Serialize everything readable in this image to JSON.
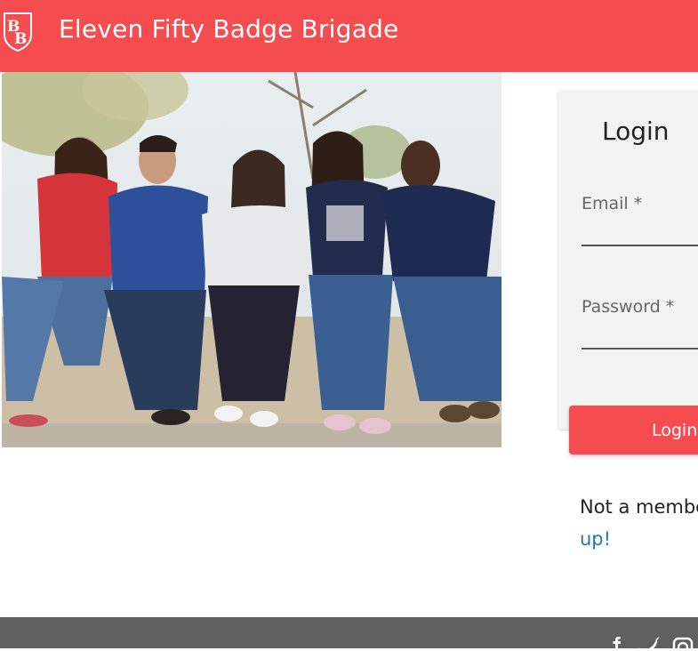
{
  "header": {
    "title": "Eleven Fifty Badge Brigade",
    "logo_icon": "bb-shield-logo-icon",
    "background_color": "#f54d4f"
  },
  "hero": {
    "image": "group-of-five-friends-sitting-photo"
  },
  "login": {
    "title": "Login",
    "email_label": "Email *",
    "password_label": "Password *",
    "submit_label": "Login",
    "signup_prefix": "Not a membe",
    "signup_link": "up!"
  },
  "footer": {
    "background_color": "#606060",
    "icons": [
      "facebook-icon",
      "twitter-icon",
      "instagram-icon"
    ]
  }
}
